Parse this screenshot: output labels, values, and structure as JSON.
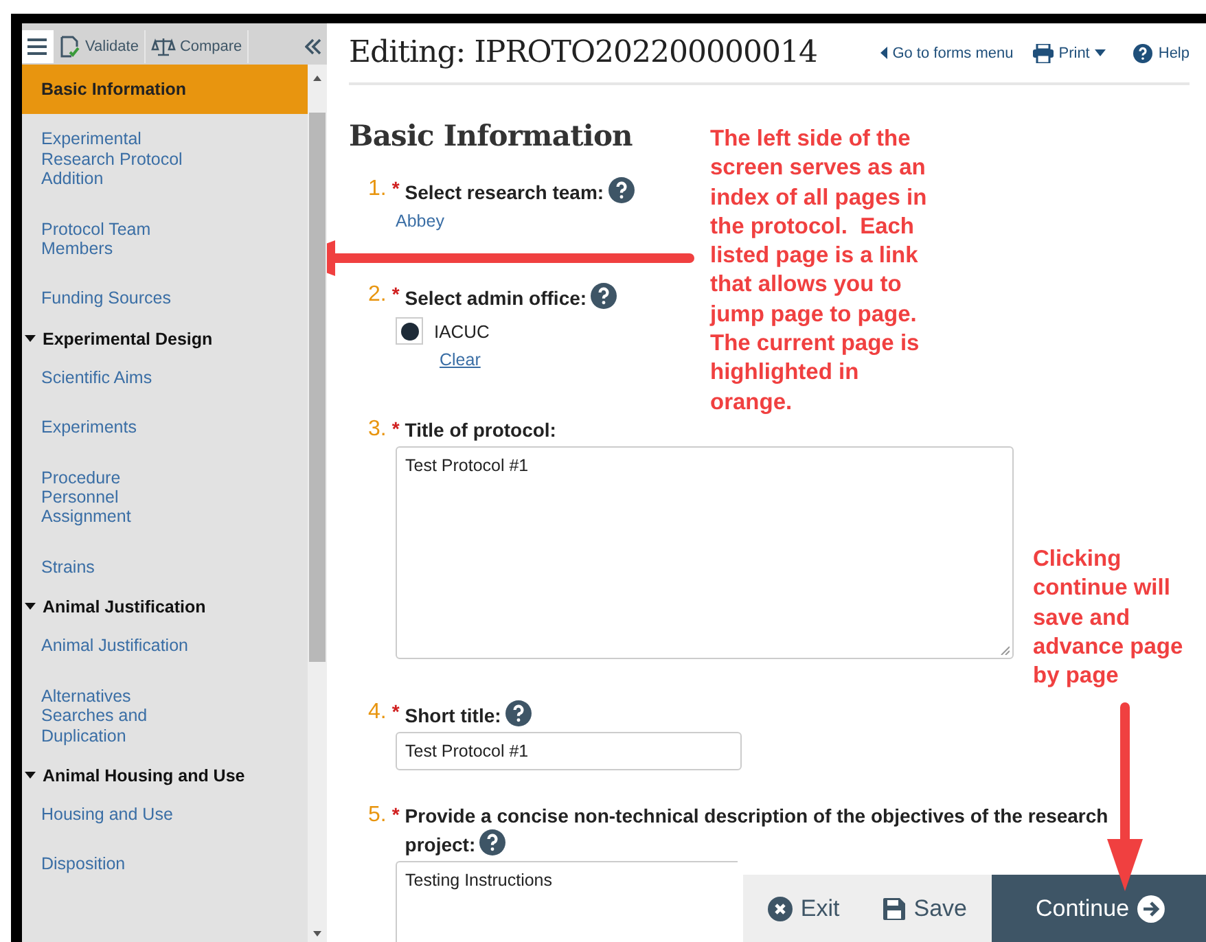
{
  "toolbar": {
    "buttons": [
      {
        "label": "Validate",
        "kind": "validate"
      },
      {
        "label": "Compare",
        "kind": "compare"
      }
    ]
  },
  "sidebar": {
    "items": [
      {
        "kind": "page",
        "label": "Basic Information",
        "selected": true
      },
      {
        "kind": "page",
        "label": "Experimental Research Protocol Addition",
        "selected": false
      },
      {
        "kind": "page",
        "label": "Protocol Team Members",
        "selected": false
      },
      {
        "kind": "page",
        "label": "Funding Sources",
        "selected": false
      },
      {
        "kind": "section",
        "label": "Experimental Design",
        "expanded": true,
        "children": [
          {
            "kind": "page",
            "label": "Scientific Aims",
            "selected": false
          },
          {
            "kind": "page",
            "label": "Experiments",
            "selected": false
          },
          {
            "kind": "page",
            "label": "Procedure Personnel Assignment",
            "selected": false
          },
          {
            "kind": "page",
            "label": "Strains",
            "selected": false
          }
        ]
      },
      {
        "kind": "section",
        "label": "Animal Justification",
        "expanded": true,
        "children": [
          {
            "kind": "page",
            "label": "Animal Justification",
            "selected": false
          },
          {
            "kind": "page",
            "label": "Alternatives Searches and Duplication",
            "selected": false
          }
        ]
      },
      {
        "kind": "section",
        "label": "Animal Housing and Use",
        "expanded": true,
        "children": [
          {
            "kind": "page",
            "label": "Housing and Use",
            "selected": false
          },
          {
            "kind": "page",
            "label": "Disposition",
            "selected": false
          }
        ]
      }
    ]
  },
  "header": {
    "title": "Editing: IPROTO202200000014",
    "links": [
      {
        "label": "Go to forms menu",
        "kind": "back"
      },
      {
        "label": "Print",
        "kind": "print"
      },
      {
        "label": "Help",
        "kind": "help"
      }
    ]
  },
  "page_title": "Basic Information",
  "questions": [
    {
      "number": "1.",
      "required_mark": "*",
      "label": "Select research team:",
      "help": true,
      "kind": "link",
      "value": "Abbey"
    },
    {
      "number": "2.",
      "required_mark": "*",
      "label": "Select admin office:",
      "help": true,
      "kind": "radio",
      "options": [
        {
          "label": "IACUC",
          "selected": true
        }
      ],
      "clear": "Clear"
    },
    {
      "number": "3.",
      "required_mark": "*",
      "label": "Title of protocol:",
      "help": false,
      "kind": "textarea",
      "value": "Test Protocol #1"
    },
    {
      "number": "4.",
      "required_mark": "*",
      "label": "Short title:",
      "help": true,
      "kind": "input",
      "value": "Test Protocol #1"
    },
    {
      "number": "5.",
      "required_mark": "*",
      "label": "Provide a concise non-technical description of the objectives of the research project:",
      "help": true,
      "kind": "textarea-short",
      "value": "Testing Instructions"
    }
  ],
  "footer": {
    "buttons": [
      {
        "label": "Exit",
        "kind": "exit"
      },
      {
        "label": "Save",
        "kind": "save"
      },
      {
        "label": "Continue",
        "kind": "continue"
      }
    ]
  },
  "annotations": [
    {
      "text": "The left side of the screen serves as an index of all pages in the protocol.  Each listed page is a link that allows you to jump page to page. The current page is highlighted in orange.",
      "kind": "arrow-left"
    },
    {
      "text": "Clicking continue will save and advance page by page",
      "kind": "arrow-down"
    }
  ]
}
